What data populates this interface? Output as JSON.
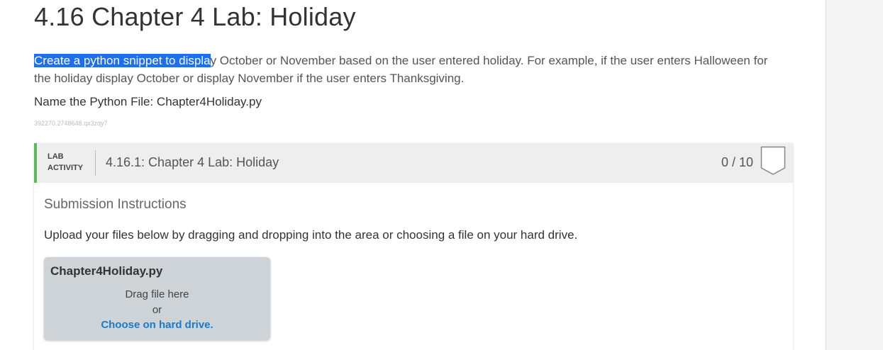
{
  "page": {
    "title": "4.16 Chapter 4 Lab: Holiday",
    "description_highlighted": "Create a python snippet to displa",
    "description_rest": "y October or November based on the user entered holiday. For example, if the user enters Halloween for the holiday display October or display November if the user enters Thanksgiving.",
    "file_name_line": "Name the Python File: Chapter4Holiday.py",
    "tracking_id": "392270.2748648.qx3zqy7"
  },
  "activity": {
    "type_line1": "LAB",
    "type_line2": "ACTIVITY",
    "title": "4.16.1: Chapter 4 Lab: Holiday",
    "score": "0 / 10",
    "accent_color": "#5cb85c"
  },
  "submission": {
    "heading": "Submission Instructions",
    "instructions": "Upload your files below by dragging and dropping into the area or choosing a file on your hard drive.",
    "drop_zone": {
      "file_name": "Chapter4Holiday.py",
      "drag_text": "Drag file here",
      "or_text": "or",
      "choose_link": "Choose on hard drive."
    }
  }
}
